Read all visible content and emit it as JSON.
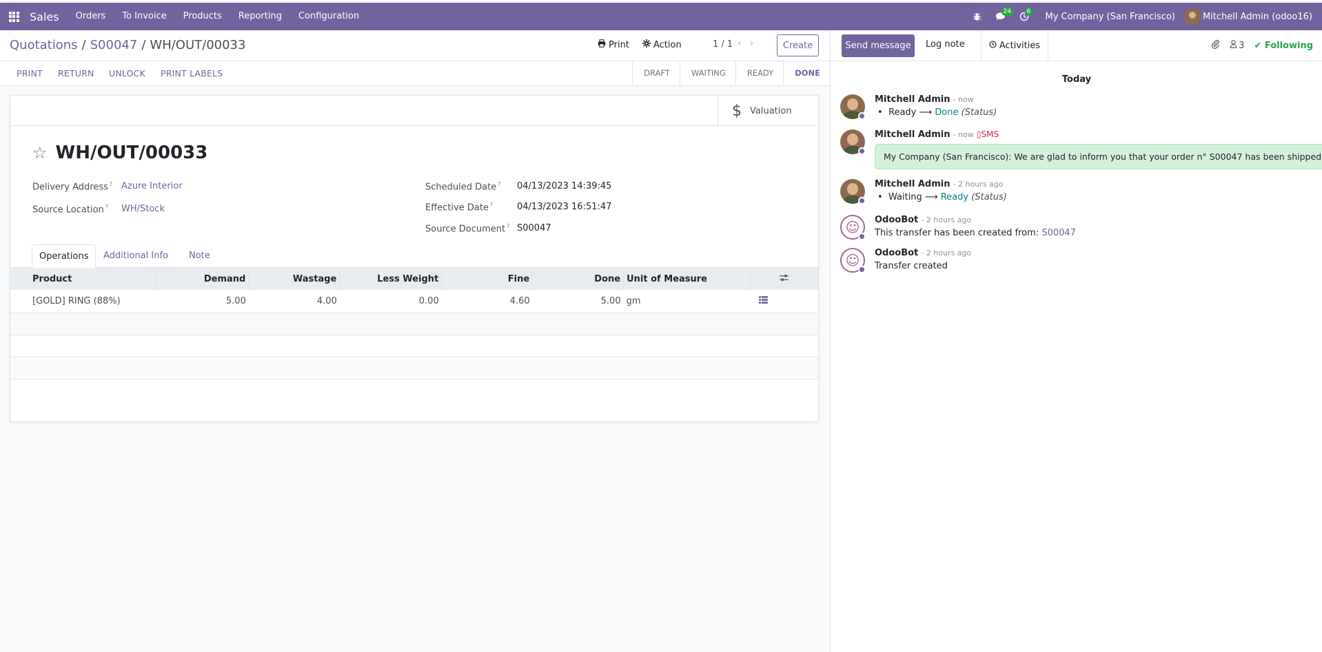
{
  "navbar": {
    "app_name": "Sales",
    "menu": [
      "Orders",
      "To Invoice",
      "Products",
      "Reporting",
      "Configuration"
    ],
    "messages_badge": "24",
    "activities_badge": "6",
    "company": "My Company (San Francisco)",
    "user": "Mitchell Admin (odoo16)",
    "brand_color": "#71639e"
  },
  "breadcrumb": {
    "root": "Quotations",
    "parent": "S00047",
    "current": "WH/OUT/00033",
    "separator": "/"
  },
  "control": {
    "print_label": "Print",
    "action_label": "Action",
    "pager": "1 / 1",
    "create_label": "Create"
  },
  "statusbar": {
    "buttons": [
      "PRINT",
      "RETURN",
      "UNLOCK",
      "PRINT LABELS"
    ],
    "steps": [
      "DRAFT",
      "WAITING",
      "READY",
      "DONE"
    ],
    "active_step": "DONE"
  },
  "form": {
    "valuation_label": "Valuation",
    "title": "WH/OUT/00033",
    "delivery_address_label": "Delivery Address",
    "delivery_address": "Azure Interior",
    "source_location_label": "Source Location",
    "source_location": "WH/Stock",
    "scheduled_date_label": "Scheduled Date",
    "scheduled_date": "04/13/2023 14:39:45",
    "effective_date_label": "Effective Date",
    "effective_date": "04/13/2023 16:51:47",
    "source_document_label": "Source Document",
    "source_document": "S00047",
    "help_mark": "?",
    "tabs": [
      "Operations",
      "Additional Info",
      "Note"
    ]
  },
  "operations": {
    "columns": [
      "Product",
      "Demand",
      "Wastage",
      "Less Weight",
      "Fine",
      "Done",
      "Unit of Measure"
    ],
    "rows": [
      {
        "product": "[GOLD] RING (88%)",
        "demand": "5.00",
        "wastage": "4.00",
        "less_weight": "0.00",
        "fine": "4.60",
        "done": "5.00",
        "uom": "gm"
      }
    ]
  },
  "chatter": {
    "send_message": "Send message",
    "log_note": "Log note",
    "activities": "Activities",
    "followers_count": "3",
    "following": "Following",
    "date_separator": "Today",
    "messages": [
      {
        "author": "Mitchell Admin",
        "time": "- now",
        "old": "Ready",
        "new": "Done",
        "field": "(Status)"
      },
      {
        "author": "Mitchell Admin",
        "time": "- now",
        "sms": "SMS",
        "text": "My Company (San Francisco): We are glad to inform you that your order n° S00047 has been shipped."
      },
      {
        "author": "Mitchell Admin",
        "time": "- 2 hours ago",
        "old": "Waiting",
        "new": "Ready",
        "field": "(Status)"
      },
      {
        "author": "OdooBot",
        "time": "- 2 hours ago",
        "text": "This transfer has been created from:",
        "link": "S00047"
      },
      {
        "author": "OdooBot",
        "time": "- 2 hours ago",
        "text": "Transfer created"
      }
    ]
  }
}
